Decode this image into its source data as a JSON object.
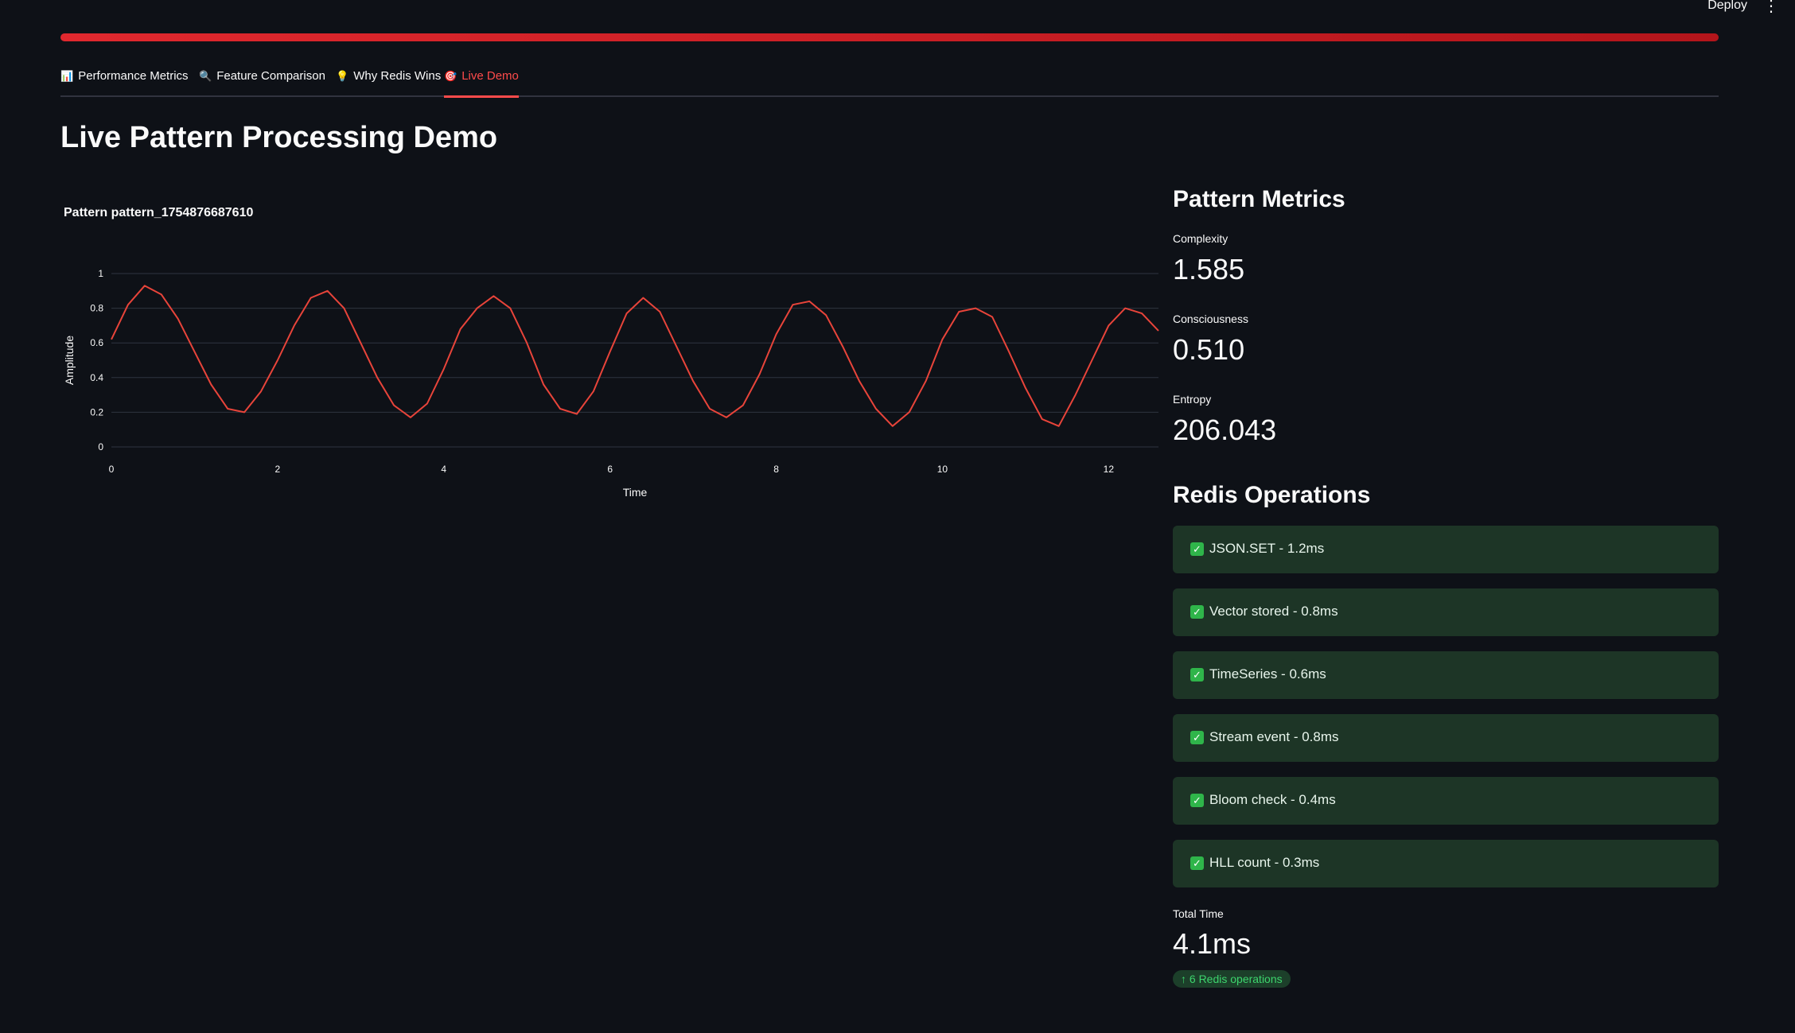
{
  "header": {
    "deploy_label": "Deploy",
    "menu_icon": "kebab-menu-icon"
  },
  "tabs": [
    {
      "icon": "📊",
      "label": "Performance Metrics",
      "active": false
    },
    {
      "icon": "🔍",
      "label": "Feature Comparison",
      "active": false
    },
    {
      "icon": "💡",
      "label": "Why Redis Wins",
      "active": false
    },
    {
      "icon": "🎯",
      "label": "Live Demo",
      "active": true
    }
  ],
  "main": {
    "title": "Live Pattern Processing Demo"
  },
  "chart_data": {
    "type": "line",
    "title": "Pattern pattern_1754876687610",
    "xlabel": "Time",
    "ylabel": "Amplitude",
    "xlim": [
      0,
      12.6
    ],
    "ylim": [
      0,
      1
    ],
    "xticks": [
      0,
      2,
      4,
      6,
      8,
      10,
      12
    ],
    "yticks": [
      0,
      0.2,
      0.4,
      0.6,
      0.8,
      1
    ],
    "grid": true,
    "line_color": "#e8443a",
    "series": [
      {
        "x": [
          0,
          0.2,
          0.4,
          0.6,
          0.8,
          1.0,
          1.2,
          1.4,
          1.6,
          1.8,
          2.0,
          2.2,
          2.4,
          2.6,
          2.8,
          3.0,
          3.2,
          3.4,
          3.6,
          3.8,
          4.0,
          4.2,
          4.4,
          4.6,
          4.8,
          5.0,
          5.2,
          5.4,
          5.6,
          5.8,
          6.0,
          6.2,
          6.4,
          6.6,
          6.8,
          7.0,
          7.2,
          7.4,
          7.6,
          7.8,
          8.0,
          8.2,
          8.4,
          8.6,
          8.8,
          9.0,
          9.2,
          9.4,
          9.6,
          9.8,
          10.0,
          10.2,
          10.4,
          10.6,
          10.8,
          11.0,
          11.2,
          11.4,
          11.6,
          11.8,
          12.0,
          12.2,
          12.4,
          12.6
        ],
        "values": [
          0.62,
          0.82,
          0.93,
          0.88,
          0.74,
          0.55,
          0.36,
          0.22,
          0.2,
          0.32,
          0.5,
          0.7,
          0.86,
          0.9,
          0.8,
          0.6,
          0.4,
          0.24,
          0.17,
          0.25,
          0.45,
          0.68,
          0.8,
          0.87,
          0.8,
          0.6,
          0.36,
          0.22,
          0.19,
          0.32,
          0.55,
          0.77,
          0.86,
          0.78,
          0.58,
          0.38,
          0.22,
          0.17,
          0.24,
          0.42,
          0.65,
          0.82,
          0.84,
          0.76,
          0.58,
          0.38,
          0.22,
          0.12,
          0.2,
          0.38,
          0.62,
          0.78,
          0.8,
          0.75,
          0.55,
          0.34,
          0.16,
          0.12,
          0.3,
          0.5,
          0.7,
          0.8,
          0.77,
          0.67
        ]
      }
    ]
  },
  "pattern_metrics": {
    "title": "Pattern Metrics",
    "complexity_label": "Complexity",
    "complexity_value": "1.585",
    "consciousness_label": "Consciousness",
    "consciousness_value": "0.510",
    "entropy_label": "Entropy",
    "entropy_value": "206.043"
  },
  "redis_operations": {
    "title": "Redis Operations",
    "items": [
      "JSON.SET - 1.2ms",
      "Vector stored - 0.8ms",
      "TimeSeries - 0.6ms",
      "Stream event - 0.8ms",
      "Bloom check - 0.4ms",
      "HLL count - 0.3ms"
    ]
  },
  "total": {
    "label": "Total Time",
    "value": "4.1ms",
    "delta": "↑ 6 Redis operations"
  }
}
